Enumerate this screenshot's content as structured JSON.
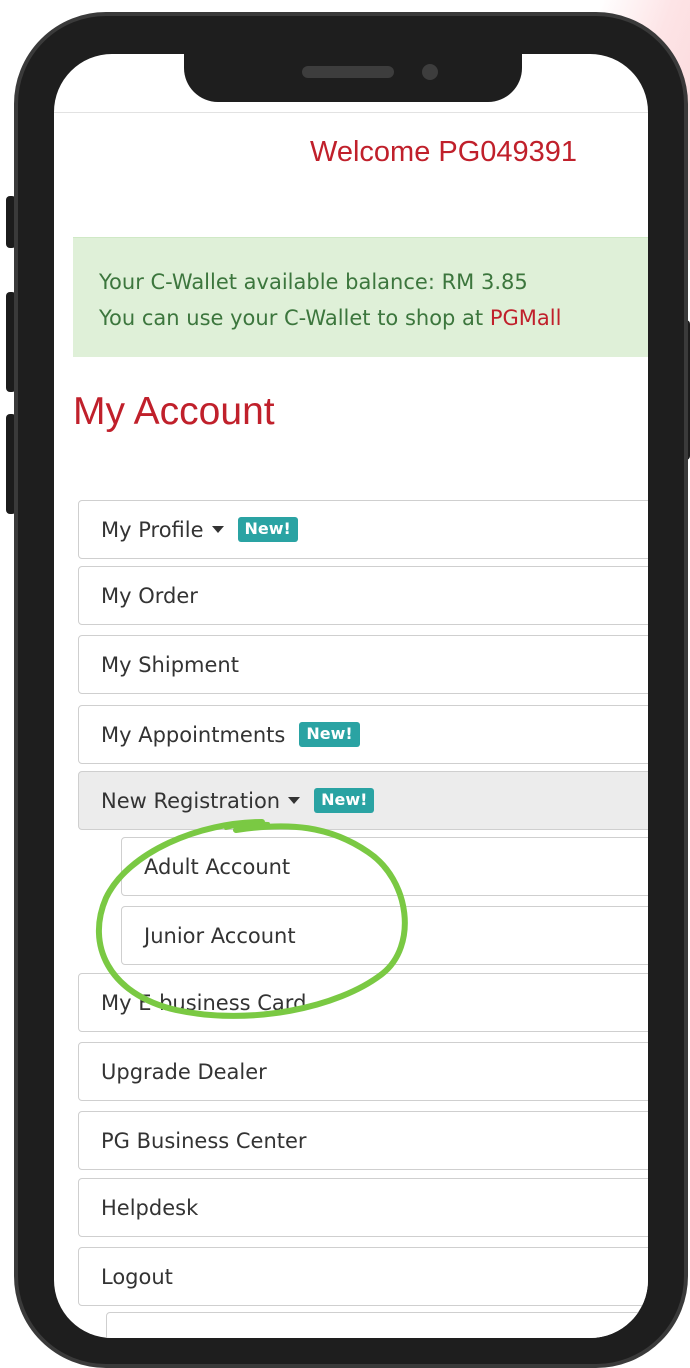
{
  "header": {
    "welcome_text": "Welcome PG049391"
  },
  "wallet": {
    "line1": "Your C-Wallet available balance: RM 3.85",
    "line2_prefix": "You can use your C-Wallet to shop at ",
    "line2_link": "PGMall"
  },
  "page": {
    "title": "My Account"
  },
  "menu": {
    "my_profile": {
      "label": "My Profile",
      "badge": "New!",
      "icon": "caret-down-icon"
    },
    "my_order": {
      "label": "My Order"
    },
    "my_shipment": {
      "label": "My Shipment"
    },
    "my_appointments": {
      "label": "My Appointments",
      "badge": "New!"
    },
    "new_registration": {
      "label": "New Registration",
      "badge": "New!",
      "icon": "caret-down-icon"
    },
    "adult_account": {
      "label": "Adult Account"
    },
    "junior_account": {
      "label": "Junior Account"
    },
    "my_ebusiness_card": {
      "label": "My E-business Card"
    },
    "upgrade_dealer": {
      "label": "Upgrade Dealer"
    },
    "pg_business_center": {
      "label": "PG Business Center"
    },
    "helpdesk": {
      "label": "Helpdesk"
    },
    "logout": {
      "label": "Logout"
    }
  },
  "colors": {
    "brand_red": "#c0202b",
    "badge_teal": "#2aa3a3",
    "alert_green_bg": "#dff0d8",
    "alert_green_text": "#3c763d",
    "annotation_green": "#7ac943"
  }
}
